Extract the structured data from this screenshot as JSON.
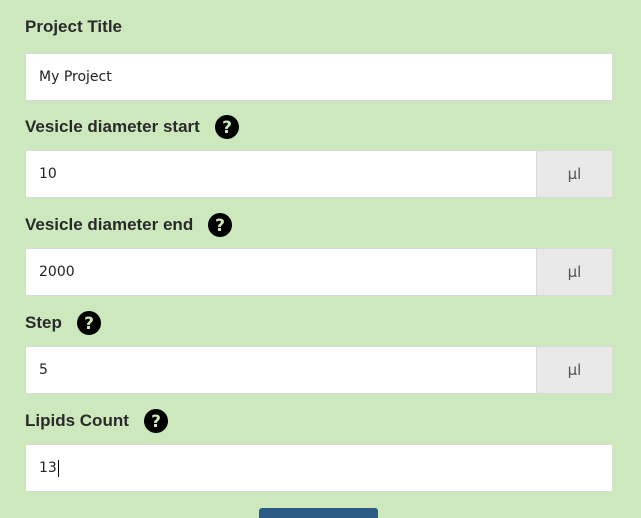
{
  "form": {
    "project_title": {
      "label": "Project Title",
      "value": "My Project"
    },
    "vesicle_start": {
      "label": "Vesicle diameter start",
      "value": "10",
      "unit": "μl",
      "help_icon": "question-circle-icon"
    },
    "vesicle_end": {
      "label": "Vesicle diameter end",
      "value": "2000",
      "unit": "μl",
      "help_icon": "question-circle-icon"
    },
    "step": {
      "label": "Step",
      "value": "5",
      "unit": "μl",
      "help_icon": "question-circle-icon"
    },
    "lipids_count": {
      "label": "Lipids Count",
      "value": "13",
      "help_icon": "question-circle-icon"
    }
  },
  "colors": {
    "background": "#cde8bd",
    "addon_background": "#e9e9e9",
    "submit_button": "#2a5a85"
  }
}
